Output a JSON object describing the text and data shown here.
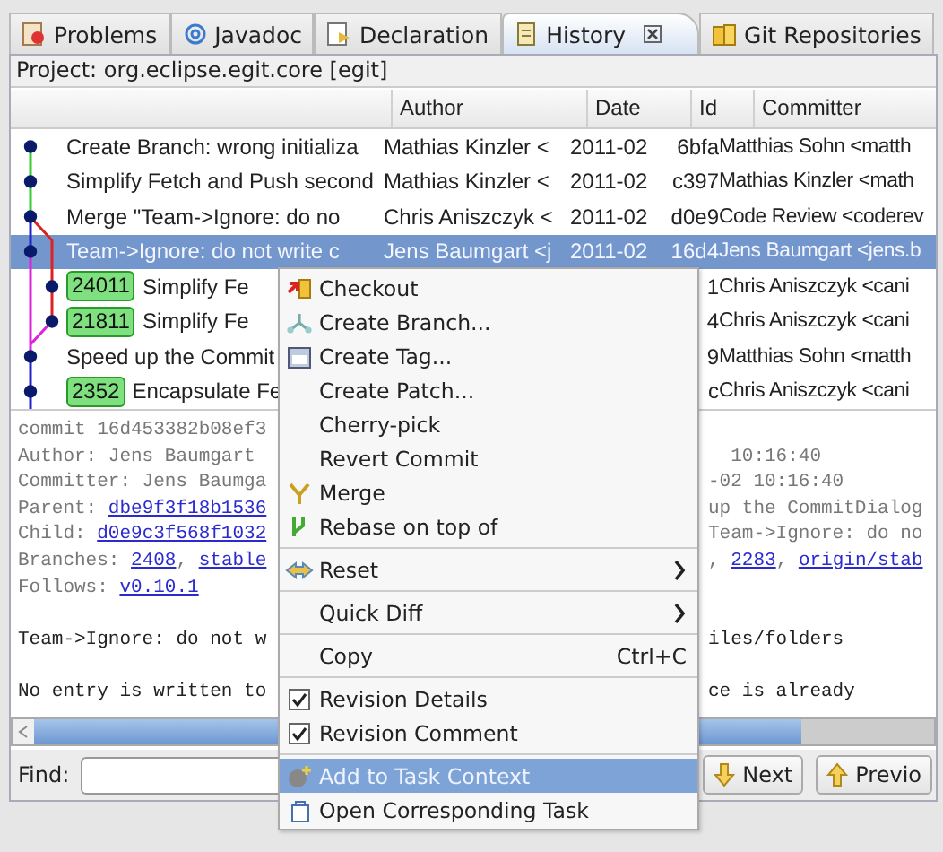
{
  "tabs": [
    {
      "label": "Problems",
      "selected": false
    },
    {
      "label": "Javadoc",
      "selected": false
    },
    {
      "label": "Declaration",
      "selected": false
    },
    {
      "label": "History",
      "selected": true
    },
    {
      "label": "Git Repositories",
      "selected": false
    }
  ],
  "project": "Project: org.eclipse.egit.core [egit]",
  "table": {
    "columns": [
      "Author",
      "Date",
      "Id",
      "Committer"
    ],
    "rows": [
      {
        "message": "Create Branch: wrong initializa",
        "author": "Mathias Kinzler <",
        "date": "2011-02",
        "id": "6bfa",
        "committer": "Matthias Sohn <matth",
        "selected": false
      },
      {
        "message": "Simplify Fetch and Push second",
        "author": "Mathias Kinzler <",
        "date": "2011-02",
        "id": "c397",
        "committer": "Mathias Kinzler <math",
        "selected": false
      },
      {
        "message": "Merge \"Team->Ignore: do no",
        "author": "Chris Aniszczyk <",
        "date": "2011-02",
        "id": "d0e9",
        "committer": "Code Review <coderev",
        "selected": false
      },
      {
        "message": "Team->Ignore: do not write c",
        "author": "Jens Baumgart <j",
        "date": "2011-02",
        "id": "16d4",
        "committer": "Jens Baumgart <jens.b",
        "selected": true
      },
      {
        "badge": "24011",
        "message": "Simplify Fe",
        "id": "1",
        "committer": "Chris Aniszczyk <cani",
        "selected": false
      },
      {
        "badge": "21811",
        "message": "Simplify Fe",
        "id": "4",
        "committer": "Chris Aniszczyk <cani",
        "selected": false
      },
      {
        "message": "Speed up the Commit",
        "id": "9",
        "committer": "Matthias Sohn <matth",
        "selected": false
      },
      {
        "badge": "2352",
        "message": "Encapsulate Fe",
        "id": "c",
        "committer": "Chris Aniszczyk <cani",
        "selected": false
      }
    ]
  },
  "details": [
    {
      "kind": "text",
      "left": [
        {
          "text": "commit 16d453382b08ef3",
          "kind": "meta"
        }
      ]
    },
    {
      "kind": "text",
      "left": [
        {
          "text": "Author: Jens Baumgart",
          "kind": "meta"
        }
      ],
      "right": [
        {
          "text": "  10:16:40",
          "kind": "meta"
        }
      ]
    },
    {
      "kind": "text",
      "left": [
        {
          "text": "Committer: Jens Baumga",
          "kind": "meta"
        }
      ],
      "right": [
        {
          "text": "-02 10:16:40",
          "kind": "meta"
        }
      ]
    },
    {
      "kind": "text",
      "left": [
        {
          "text": "Parent: ",
          "kind": "meta"
        },
        {
          "text": "dbe9f3f18b1536",
          "kind": "link"
        }
      ],
      "right": [
        {
          "text": "up the CommitDialog",
          "kind": "meta"
        }
      ]
    },
    {
      "kind": "text",
      "left": [
        {
          "text": "Child: ",
          "kind": "meta"
        },
        {
          "text": "d0e9c3f568f1032",
          "kind": "link"
        }
      ],
      "right": [
        {
          "text": "Team->Ignore: do no",
          "kind": "meta"
        }
      ]
    },
    {
      "kind": "text",
      "left": [
        {
          "text": "Branches: ",
          "kind": "meta"
        },
        {
          "text": "2408",
          "kind": "link"
        },
        {
          "text": ", ",
          "kind": "meta"
        },
        {
          "text": "stable",
          "kind": "link"
        }
      ],
      "right": [
        {
          "text": ", ",
          "kind": "meta"
        },
        {
          "text": "2283",
          "kind": "link"
        },
        {
          "text": ", ",
          "kind": "meta"
        },
        {
          "text": "origin/stab",
          "kind": "link"
        }
      ]
    },
    {
      "kind": "text",
      "left": [
        {
          "text": "Follows: ",
          "kind": "meta"
        },
        {
          "text": "v0.10.1",
          "kind": "link"
        }
      ]
    },
    {
      "kind": "blank"
    },
    {
      "kind": "text",
      "left": [
        {
          "text": "Team->Ignore: do not w",
          "kind": "body"
        }
      ],
      "right": [
        {
          "text": "iles/folders",
          "kind": "body"
        }
      ]
    },
    {
      "kind": "blank"
    },
    {
      "kind": "text",
      "left": [
        {
          "text": "No entry is written to",
          "kind": "body"
        }
      ],
      "right": [
        {
          "text": "ce is already",
          "kind": "body"
        }
      ]
    }
  ],
  "find": {
    "label": "Find:",
    "buttons": [
      "Next",
      "Previo"
    ]
  },
  "menu": [
    {
      "kind": "item",
      "label": "Checkout",
      "selected": false
    },
    {
      "kind": "item",
      "label": "Create Branch...",
      "selected": false
    },
    {
      "kind": "item",
      "label": "Create Tag...",
      "selected": false
    },
    {
      "kind": "item",
      "label": "Create Patch...",
      "selected": false
    },
    {
      "kind": "item",
      "label": "Cherry-pick",
      "selected": false
    },
    {
      "kind": "item",
      "label": "Revert Commit",
      "selected": false
    },
    {
      "kind": "item",
      "label": "Merge",
      "selected": false
    },
    {
      "kind": "item",
      "label": "Rebase on top of",
      "selected": false
    },
    {
      "kind": "separator"
    },
    {
      "kind": "submenu",
      "label": "Reset",
      "selected": false
    },
    {
      "kind": "separator"
    },
    {
      "kind": "submenu",
      "label": "Quick Diff",
      "selected": false
    },
    {
      "kind": "separator"
    },
    {
      "kind": "item",
      "label": "Copy",
      "shortcut": "Ctrl+C",
      "selected": false
    },
    {
      "kind": "separator"
    },
    {
      "kind": "check",
      "label": "Revision Details",
      "checked": true,
      "selected": false
    },
    {
      "kind": "check",
      "label": "Revision Comment",
      "checked": true,
      "selected": false
    },
    {
      "kind": "separator"
    },
    {
      "kind": "item",
      "label": "Add to Task Context",
      "selected": true
    },
    {
      "kind": "item",
      "label": "Open Corresponding Task",
      "selected": false
    }
  ]
}
